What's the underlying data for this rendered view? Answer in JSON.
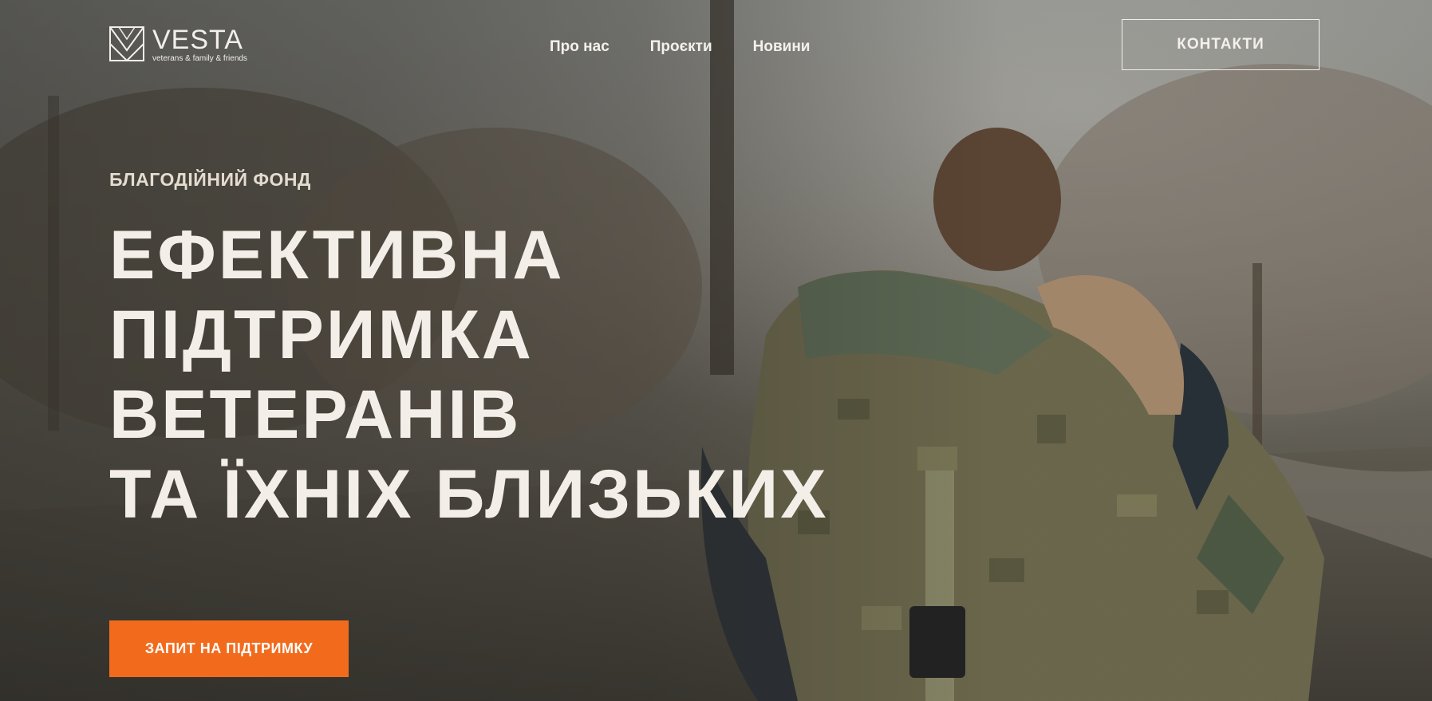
{
  "brand": {
    "name": "VESTA",
    "tagline": "veterans & family & friends"
  },
  "nav": {
    "items": [
      {
        "label": "Про нас"
      },
      {
        "label": "Проєкти"
      },
      {
        "label": "Новини"
      }
    ],
    "contacts_label": "КОНТАКТИ"
  },
  "hero": {
    "kicker": "БЛАГОДІЙНИЙ ФОНД",
    "headline_lines": [
      "ЕФЕКТИВНА",
      "ПІДТРИМКА",
      "ВЕТЕРАНІВ",
      "ТА ЇХНІХ БЛИЗЬКИХ"
    ],
    "cta_label": "ЗАПИТ НА ПІДТРИМКУ"
  },
  "colors": {
    "accent": "#f26b1d",
    "text_light": "#f3efe8"
  }
}
